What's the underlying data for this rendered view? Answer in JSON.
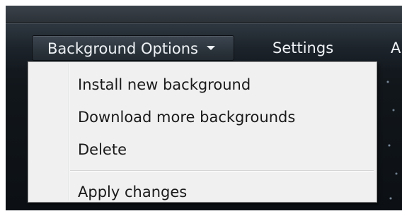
{
  "menubar": {
    "items": [
      {
        "label": "Background Options",
        "has_dropdown": true,
        "state": "open"
      },
      {
        "label": "Settings"
      },
      {
        "label": "A"
      }
    ]
  },
  "dropdown": {
    "items": [
      {
        "label": "Install new background"
      },
      {
        "label": "Download more backgrounds"
      },
      {
        "label": "Delete"
      },
      {
        "label": "Apply changes"
      }
    ]
  },
  "colors": {
    "menubar_bg": "#1c232a",
    "menu_text": "#eef2f6",
    "dropdown_bg": "#f0f0f0",
    "dropdown_text": "#1a1a1a"
  },
  "icons": {
    "dropdown_caret": "chevron-down-icon"
  }
}
